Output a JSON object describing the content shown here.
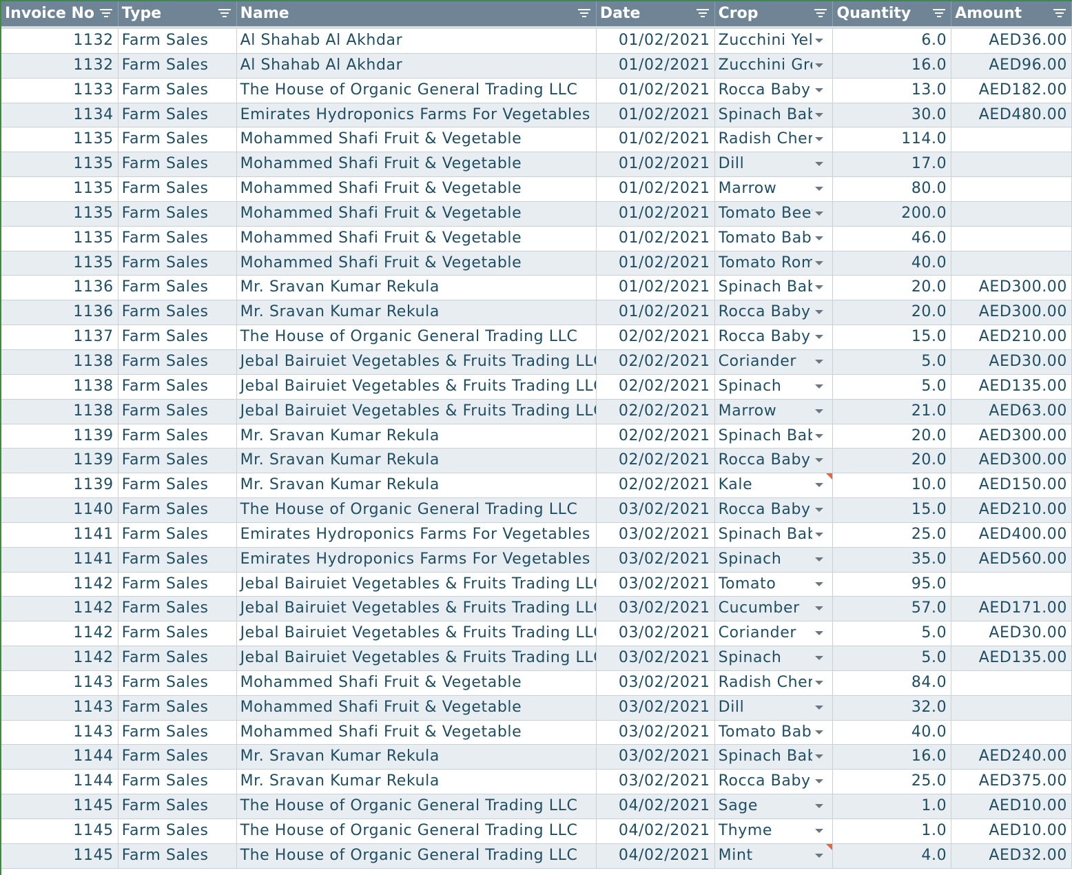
{
  "columns": [
    {
      "label": "Invoice No",
      "filter_icon": "filter-icon"
    },
    {
      "label": "Type",
      "filter_icon": "filter-icon"
    },
    {
      "label": "Name",
      "filter_icon": "filter-icon"
    },
    {
      "label": "Date",
      "filter_icon": "filter-icon"
    },
    {
      "label": "Crop",
      "filter_icon": "filter-icon"
    },
    {
      "label": "Quantity",
      "filter_icon": "filter-icon"
    },
    {
      "label": "Amount",
      "filter_icon": "filter-icon"
    }
  ],
  "rows": [
    {
      "invoice": "1132",
      "type": "Farm Sales",
      "name": "Al Shahab Al Akhdar",
      "date": "01/02/2021",
      "crop": "Zucchini Yel",
      "quantity": "6.0",
      "amount": "AED36.00"
    },
    {
      "invoice": "1132",
      "type": "Farm Sales",
      "name": "Al Shahab Al Akhdar",
      "date": "01/02/2021",
      "crop": "Zucchini Gre",
      "quantity": "16.0",
      "amount": "AED96.00"
    },
    {
      "invoice": "1133",
      "type": "Farm Sales",
      "name": "The House of Organic General Trading LLC",
      "date": "01/02/2021",
      "crop": "Rocca Baby",
      "quantity": "13.0",
      "amount": "AED182.00"
    },
    {
      "invoice": "1134",
      "type": "Farm Sales",
      "name": "Emirates Hydroponics Farms For Vegetables",
      "date": "01/02/2021",
      "crop": "Spinach Bab",
      "quantity": "30.0",
      "amount": "AED480.00"
    },
    {
      "invoice": "1135",
      "type": "Farm Sales",
      "name": "Mohammed Shafi Fruit & Vegetable",
      "date": "01/02/2021",
      "crop": "Radish Cher",
      "quantity": "114.0",
      "amount": ""
    },
    {
      "invoice": "1135",
      "type": "Farm Sales",
      "name": "Mohammed Shafi Fruit & Vegetable",
      "date": "01/02/2021",
      "crop": "Dill",
      "quantity": "17.0",
      "amount": ""
    },
    {
      "invoice": "1135",
      "type": "Farm Sales",
      "name": "Mohammed Shafi Fruit & Vegetable",
      "date": "01/02/2021",
      "crop": "Marrow",
      "quantity": "80.0",
      "amount": ""
    },
    {
      "invoice": "1135",
      "type": "Farm Sales",
      "name": "Mohammed Shafi Fruit & Vegetable",
      "date": "01/02/2021",
      "crop": "Tomato Beef",
      "quantity": "200.0",
      "amount": ""
    },
    {
      "invoice": "1135",
      "type": "Farm Sales",
      "name": "Mohammed Shafi Fruit & Vegetable",
      "date": "01/02/2021",
      "crop": "Tomato Bab",
      "quantity": "46.0",
      "amount": ""
    },
    {
      "invoice": "1135",
      "type": "Farm Sales",
      "name": "Mohammed Shafi Fruit & Vegetable",
      "date": "01/02/2021",
      "crop": "Tomato Rom",
      "quantity": "40.0",
      "amount": ""
    },
    {
      "invoice": "1136",
      "type": "Farm Sales",
      "name": "Mr. Sravan Kumar Rekula",
      "date": "01/02/2021",
      "crop": "Spinach Bab",
      "quantity": "20.0",
      "amount": "AED300.00"
    },
    {
      "invoice": "1136",
      "type": "Farm Sales",
      "name": "Mr. Sravan Kumar Rekula",
      "date": "01/02/2021",
      "crop": "Rocca Baby",
      "quantity": "20.0",
      "amount": "AED300.00"
    },
    {
      "invoice": "1137",
      "type": "Farm Sales",
      "name": "The House of Organic General Trading LLC",
      "date": "02/02/2021",
      "crop": "Rocca Baby",
      "quantity": "15.0",
      "amount": "AED210.00"
    },
    {
      "invoice": "1138",
      "type": "Farm Sales",
      "name": "Jebal Bairuiet Vegetables & Fruits Trading LLC",
      "date": "02/02/2021",
      "crop": "Coriander",
      "quantity": "5.0",
      "amount": "AED30.00"
    },
    {
      "invoice": "1138",
      "type": "Farm Sales",
      "name": "Jebal Bairuiet Vegetables & Fruits Trading LLC",
      "date": "02/02/2021",
      "crop": "Spinach",
      "quantity": "5.0",
      "amount": "AED135.00"
    },
    {
      "invoice": "1138",
      "type": "Farm Sales",
      "name": "Jebal Bairuiet Vegetables & Fruits Trading LLC",
      "date": "02/02/2021",
      "crop": "Marrow",
      "quantity": "21.0",
      "amount": "AED63.00"
    },
    {
      "invoice": "1139",
      "type": "Farm Sales",
      "name": "Mr. Sravan Kumar Rekula",
      "date": "02/02/2021",
      "crop": "Spinach Bab",
      "quantity": "20.0",
      "amount": "AED300.00"
    },
    {
      "invoice": "1139",
      "type": "Farm Sales",
      "name": "Mr. Sravan Kumar Rekula",
      "date": "02/02/2021",
      "crop": "Rocca Baby",
      "quantity": "20.0",
      "amount": "AED300.00"
    },
    {
      "invoice": "1139",
      "type": "Farm Sales",
      "name": "Mr. Sravan Kumar Rekula",
      "date": "02/02/2021",
      "crop": "Kale",
      "quantity": "10.0",
      "amount": "AED150.00",
      "note": true
    },
    {
      "invoice": "1140",
      "type": "Farm Sales",
      "name": "The House of Organic General Trading LLC",
      "date": "03/02/2021",
      "crop": "Rocca Baby",
      "quantity": "15.0",
      "amount": "AED210.00"
    },
    {
      "invoice": "1141",
      "type": "Farm Sales",
      "name": "Emirates Hydroponics Farms For Vegetables",
      "date": "03/02/2021",
      "crop": "Spinach Bab",
      "quantity": "25.0",
      "amount": "AED400.00"
    },
    {
      "invoice": "1141",
      "type": "Farm Sales",
      "name": "Emirates Hydroponics Farms For Vegetables",
      "date": "03/02/2021",
      "crop": "Spinach",
      "quantity": "35.0",
      "amount": "AED560.00"
    },
    {
      "invoice": "1142",
      "type": "Farm Sales",
      "name": "Jebal Bairuiet Vegetables & Fruits Trading LLC",
      "date": "03/02/2021",
      "crop": "Tomato",
      "quantity": "95.0",
      "amount": ""
    },
    {
      "invoice": "1142",
      "type": "Farm Sales",
      "name": "Jebal Bairuiet Vegetables & Fruits Trading LLC",
      "date": "03/02/2021",
      "crop": "Cucumber",
      "quantity": "57.0",
      "amount": "AED171.00"
    },
    {
      "invoice": "1142",
      "type": "Farm Sales",
      "name": "Jebal Bairuiet Vegetables & Fruits Trading LLC",
      "date": "03/02/2021",
      "crop": "Coriander",
      "quantity": "5.0",
      "amount": "AED30.00"
    },
    {
      "invoice": "1142",
      "type": "Farm Sales",
      "name": "Jebal Bairuiet Vegetables & Fruits Trading LLC",
      "date": "03/02/2021",
      "crop": "Spinach",
      "quantity": "5.0",
      "amount": "AED135.00"
    },
    {
      "invoice": "1143",
      "type": "Farm Sales",
      "name": "Mohammed Shafi Fruit & Vegetable",
      "date": "03/02/2021",
      "crop": "Radish Cher",
      "quantity": "84.0",
      "amount": ""
    },
    {
      "invoice": "1143",
      "type": "Farm Sales",
      "name": "Mohammed Shafi Fruit & Vegetable",
      "date": "03/02/2021",
      "crop": "Dill",
      "quantity": "32.0",
      "amount": ""
    },
    {
      "invoice": "1143",
      "type": "Farm Sales",
      "name": "Mohammed Shafi Fruit & Vegetable",
      "date": "03/02/2021",
      "crop": "Tomato Bab",
      "quantity": "40.0",
      "amount": ""
    },
    {
      "invoice": "1144",
      "type": "Farm Sales",
      "name": "Mr. Sravan Kumar Rekula",
      "date": "03/02/2021",
      "crop": "Spinach Bab",
      "quantity": "16.0",
      "amount": "AED240.00"
    },
    {
      "invoice": "1144",
      "type": "Farm Sales",
      "name": "Mr. Sravan Kumar Rekula",
      "date": "03/02/2021",
      "crop": "Rocca Baby",
      "quantity": "25.0",
      "amount": "AED375.00"
    },
    {
      "invoice": "1145",
      "type": "Farm Sales",
      "name": "The House of Organic General Trading LLC",
      "date": "04/02/2021",
      "crop": "Sage",
      "quantity": "1.0",
      "amount": "AED10.00"
    },
    {
      "invoice": "1145",
      "type": "Farm Sales",
      "name": "The House of Organic General Trading LLC",
      "date": "04/02/2021",
      "crop": "Thyme",
      "quantity": "1.0",
      "amount": "AED10.00"
    },
    {
      "invoice": "1145",
      "type": "Farm Sales",
      "name": "The House of Organic General Trading LLC",
      "date": "04/02/2021",
      "crop": "Mint",
      "quantity": "4.0",
      "amount": "AED32.00",
      "note": true
    }
  ],
  "colors": {
    "header_bg": "#6f8595",
    "header_text": "#ffffff",
    "cell_text": "#1f4e62",
    "alt_row_bg": "#e8edf1",
    "note_marker": "#e8643c",
    "frame_border": "#3f8a3f"
  }
}
